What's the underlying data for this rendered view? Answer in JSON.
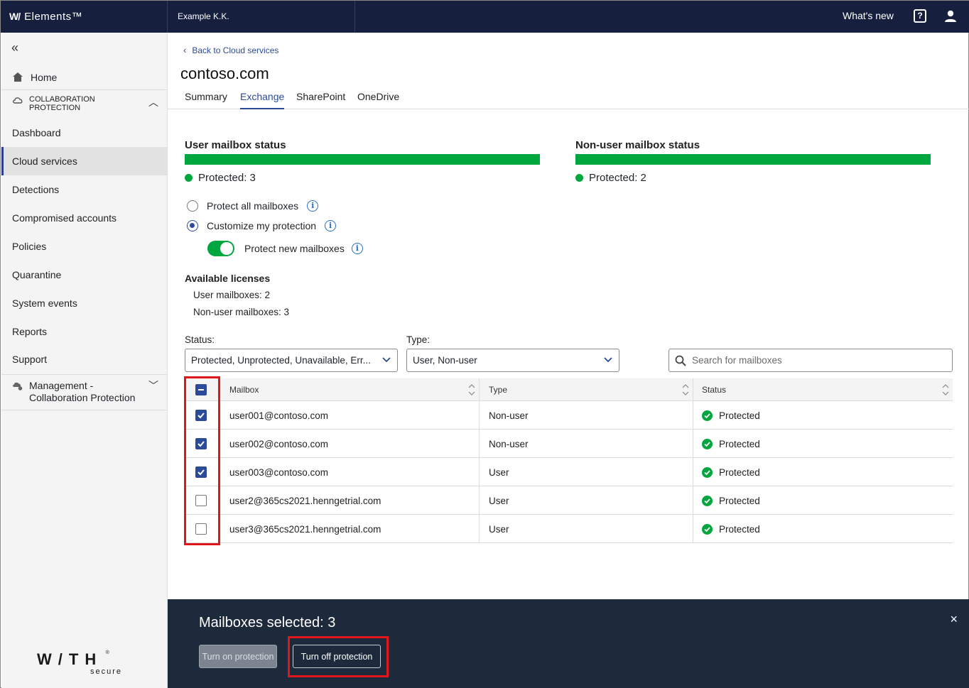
{
  "topbar": {
    "brand": "Elements™",
    "brand_mark": "W/",
    "org": "Example K.K.",
    "whats_new": "What's new",
    "help_glyph": "?"
  },
  "sidebar": {
    "home": "Home",
    "section": "COLLABORATION PROTECTION",
    "items": [
      {
        "label": "Dashboard"
      },
      {
        "label": "Cloud services"
      },
      {
        "label": "Detections"
      },
      {
        "label": "Compromised accounts"
      },
      {
        "label": "Policies"
      },
      {
        "label": "Quarantine"
      },
      {
        "label": "System events"
      },
      {
        "label": "Reports"
      },
      {
        "label": "Support"
      }
    ],
    "management": "Management - Collaboration Protection",
    "logo_big": "W/TH",
    "logo_small": "secure",
    "logo_reg": "®"
  },
  "main": {
    "back": "Back to Cloud services",
    "title": "contoso.com",
    "tabs": [
      {
        "label": "Summary"
      },
      {
        "label": "Exchange"
      },
      {
        "label": "SharePoint"
      },
      {
        "label": "OneDrive"
      }
    ],
    "user_status_title": "User mailbox status",
    "user_protected": "Protected: 3",
    "nonuser_status_title": "Non-user mailbox status",
    "nonuser_protected": "Protected: 2",
    "radio_all": "Protect all mailboxes",
    "radio_custom": "Customize my protection",
    "toggle_label": "Protect new mailboxes",
    "toggle_on": true,
    "info_glyph": "i",
    "licenses_title": "Available licenses",
    "lic_user": "User mailboxes: 2",
    "lic_nonuser": "Non-user mailboxes: 3",
    "status_label": "Status:",
    "status_value": "Protected, Unprotected, Unavailable, Err...",
    "type_label": "Type:",
    "type_value": "User, Non-user",
    "search_placeholder": "Search for mailboxes"
  },
  "table": {
    "columns": [
      "Mailbox",
      "Type",
      "Status"
    ],
    "rows": [
      {
        "mailbox": "user001@contoso.com",
        "type": "Non-user",
        "status": "Protected",
        "checked": true
      },
      {
        "mailbox": "user002@contoso.com",
        "type": "Non-user",
        "status": "Protected",
        "checked": true
      },
      {
        "mailbox": "user003@contoso.com",
        "type": "User",
        "status": "Protected",
        "checked": true
      },
      {
        "mailbox": "user2@365cs2021.henngetrial.com",
        "type": "User",
        "status": "Protected",
        "checked": false
      },
      {
        "mailbox": "user3@365cs2021.henngetrial.com",
        "type": "User",
        "status": "Protected",
        "checked": false
      }
    ]
  },
  "bottom": {
    "selected": "Mailboxes selected: 3",
    "turn_on": "Turn on protection",
    "turn_off": "Turn off protection",
    "close_glyph": "×"
  },
  "colors": {
    "navy": "#16203e",
    "accent": "#2c4a9a",
    "green": "#00a63e",
    "highlight": "#e0161b"
  }
}
